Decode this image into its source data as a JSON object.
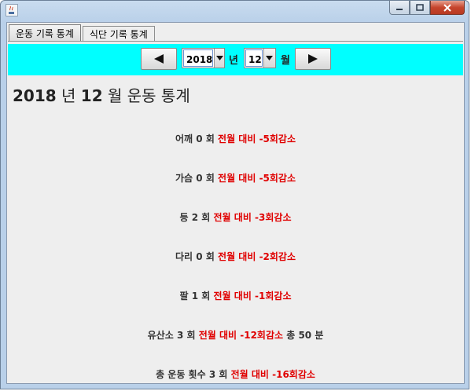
{
  "window": {
    "colors": {
      "nav_bg": "#00ffff",
      "accent_red": "#e00000"
    }
  },
  "tabs": [
    {
      "label": "운동 기록 통계",
      "active": true
    },
    {
      "label": "식단 기록 통계",
      "active": false
    }
  ],
  "nav": {
    "year": "2018",
    "year_suffix": "년",
    "month": "12",
    "month_suffix": "월",
    "prev_icon": "left-triangle-icon",
    "next_icon": "right-triangle-icon"
  },
  "heading": {
    "year": "2018",
    "year_word": "년",
    "month": "12",
    "month_word": "월",
    "title": "운동 통계"
  },
  "stats": [
    {
      "name": "어깨",
      "count": "0",
      "unit": "회",
      "compare": "전월 대비 -5회감소",
      "extra": ""
    },
    {
      "name": "가슴",
      "count": "0",
      "unit": "회",
      "compare": "전월 대비 -5회감소",
      "extra": ""
    },
    {
      "name": "등 ",
      "count": "2",
      "unit": "회",
      "compare": "전월 대비 -3회감소",
      "extra": ""
    },
    {
      "name": "다리",
      "count": "0",
      "unit": "회",
      "compare": "전월 대비 -2회감소",
      "extra": ""
    },
    {
      "name": "팔",
      "count": "1",
      "unit": "회",
      "compare": "전월 대비 -1회감소",
      "extra": ""
    },
    {
      "name": "유산소",
      "count": "3",
      "unit": "회",
      "compare": "전월 대비 -12회감소",
      "extra": "총 50 분"
    },
    {
      "name": "총 운동 횟수",
      "count": "3",
      "unit": "회",
      "compare": "전월 대비 -16회감소",
      "extra": ""
    }
  ]
}
